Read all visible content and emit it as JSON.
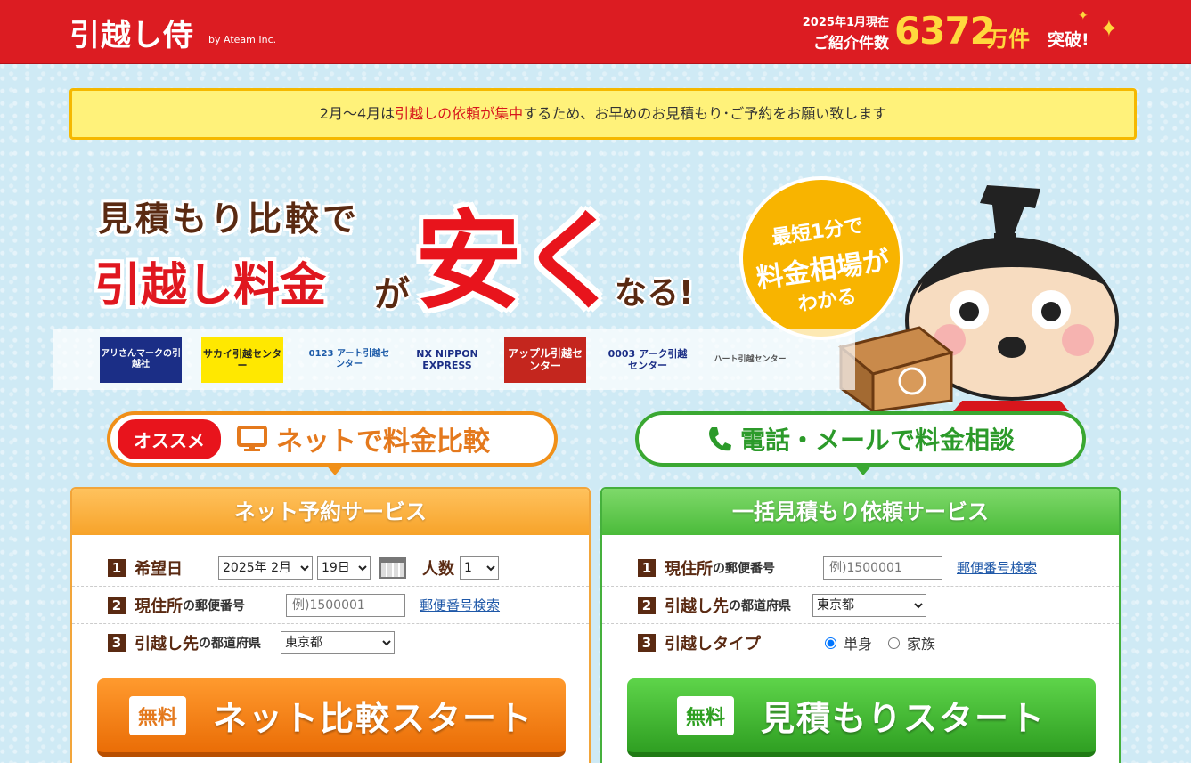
{
  "header": {
    "logo": "引越し侍",
    "logo_sub": "by Ateam Inc.",
    "note_line1": "2025年1月現在",
    "note_line2": "ご紹介件数",
    "count": "6372",
    "count_unit": "万件",
    "count_tail": "突破!"
  },
  "notice": {
    "pre": "2月〜4月は",
    "highlight": "引越しの依頼が集中",
    "post": "するため、お早めのお見積もり･ご予約をお願い致します"
  },
  "hero": {
    "line1": "見積もり比較で",
    "line2": "引越し料金",
    "ga": "が",
    "big": "安く",
    "naru": "なる!",
    "bubble": {
      "l1": "最短1分で",
      "l2": "料金相場が",
      "l3": "わかる"
    }
  },
  "logos": [
    {
      "name": "アリさんマークの引越社"
    },
    {
      "name": "サカイ引越センター"
    },
    {
      "name": "0123 アート引越センター"
    },
    {
      "name": "NX NIPPON EXPRESS"
    },
    {
      "name": "アップル引越センター"
    },
    {
      "name": "0003 アーク引越センター"
    },
    {
      "name": "ハート引越センター"
    }
  ],
  "tabs": {
    "left": {
      "badge": "オススメ",
      "label": "ネットで料金比較"
    },
    "right": {
      "label": "電話・メールで料金相談"
    }
  },
  "left_panel": {
    "title": "ネット予約サービス",
    "row1": {
      "num": "1",
      "label": "希望日",
      "month_value": "2025年 2月",
      "day_value": "19日",
      "people_label": "人数",
      "people_value": "1"
    },
    "row2": {
      "num": "2",
      "label": "現住所",
      "label_suffix": "の郵便番号",
      "zip_placeholder": "例)1500001",
      "zip_link": "郵便番号検索"
    },
    "row3": {
      "num": "3",
      "label": "引越し先",
      "label_suffix": "の都道府県",
      "pref_value": "東京都"
    },
    "cta_free": "無料",
    "cta_label": "ネット比較スタート"
  },
  "right_panel": {
    "title": "一括見積もり依頼サービス",
    "row1": {
      "num": "1",
      "label": "現住所",
      "label_suffix": "の郵便番号",
      "zip_placeholder": "例)1500001",
      "zip_link": "郵便番号検索"
    },
    "row2": {
      "num": "2",
      "label": "引越し先",
      "label_suffix": "の都道府県",
      "pref_value": "東京都"
    },
    "row3": {
      "num": "3",
      "label": "引越しタイプ",
      "option_single": "単身",
      "option_family": "家族"
    },
    "cta_free": "無料",
    "cta_label": "見積もりスタート"
  },
  "colors": {
    "brand_red": "#dc1c22",
    "accent_orange": "#f09019",
    "accent_green": "#3aa832",
    "notice_bg": "#fff27a"
  }
}
